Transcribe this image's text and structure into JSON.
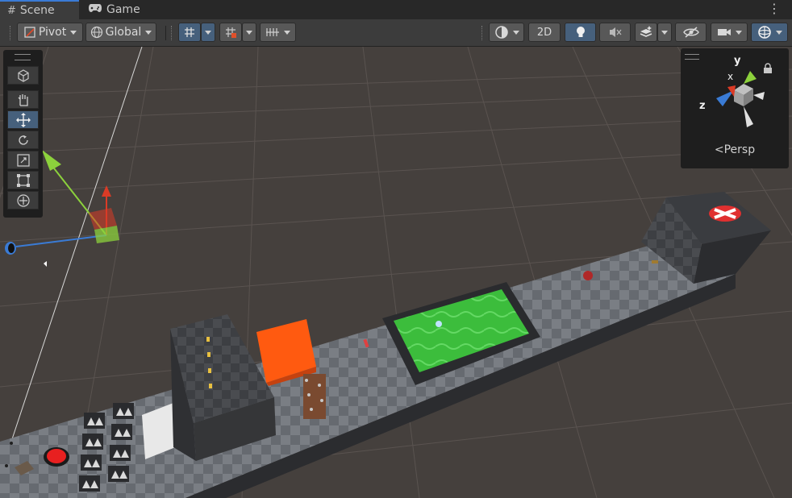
{
  "tabs": [
    {
      "label": "Scene",
      "icon": "scene-grid-icon",
      "active": true
    },
    {
      "label": "Game",
      "icon": "game-controller-icon",
      "active": false
    }
  ],
  "toolbar": {
    "pivot_label": "Pivot",
    "global_label": "Global",
    "twod_label": "2D"
  },
  "tools": [
    {
      "name": "view-tool",
      "icon": "cube-icon"
    },
    {
      "name": "hand-tool",
      "icon": "hand-icon"
    },
    {
      "name": "move-tool",
      "icon": "move-arrows-icon",
      "active": true
    },
    {
      "name": "rotate-tool",
      "icon": "rotate-icon"
    },
    {
      "name": "scale-tool",
      "icon": "scale-icon"
    },
    {
      "name": "rect-tool",
      "icon": "rect-icon"
    },
    {
      "name": "transform-tool",
      "icon": "transform-icon"
    }
  ],
  "gizmo": {
    "projection_label": "Persp",
    "axis_x": "x",
    "axis_y": "y",
    "axis_z": "z"
  },
  "colors": {
    "accent": "#3a7bd5",
    "x_axis": "#db3b26",
    "y_axis": "#8cd13c",
    "z_axis": "#3a7bd5",
    "ground_grid": "#4a4340",
    "orange_block": "#ff5a10",
    "green_pool": "#3dbd3d"
  }
}
